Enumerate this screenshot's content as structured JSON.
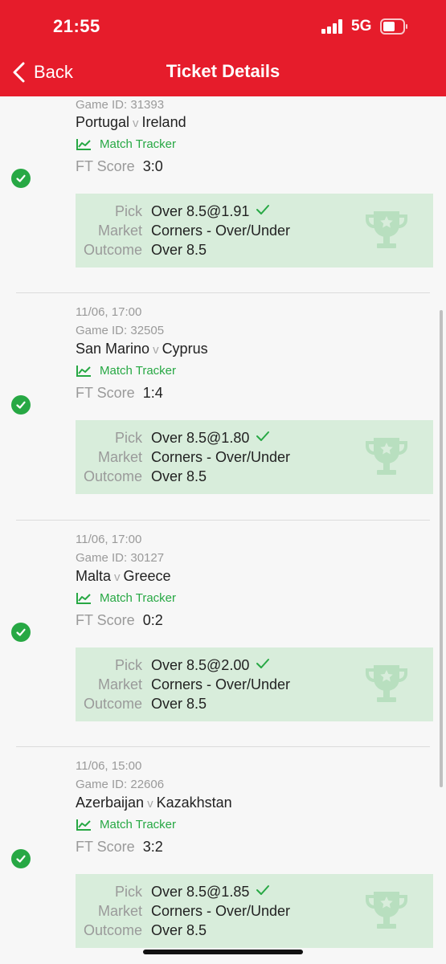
{
  "status_bar": {
    "time": "21:55",
    "network": "5G"
  },
  "nav": {
    "back_label": "Back",
    "title": "Ticket Details"
  },
  "labels": {
    "match_tracker": "Match Tracker",
    "ft_score": "FT Score",
    "pick": "Pick",
    "market": "Market",
    "outcome": "Outcome",
    "vs": "v"
  },
  "matches": [
    {
      "date": "",
      "game_id": "Game ID: 31393",
      "home": "Portugal",
      "away": "Ireland",
      "score": "3:0",
      "pick": "Over 8.5@1.91",
      "market": "Corners - Over/Under",
      "outcome": "Over 8.5"
    },
    {
      "date": "11/06, 17:00",
      "game_id": "Game ID: 32505",
      "home": "San Marino",
      "away": "Cyprus",
      "score": "1:4",
      "pick": "Over 8.5@1.80",
      "market": "Corners - Over/Under",
      "outcome": "Over 8.5"
    },
    {
      "date": "11/06, 17:00",
      "game_id": "Game ID: 30127",
      "home": "Malta",
      "away": "Greece",
      "score": "0:2",
      "pick": "Over 8.5@2.00",
      "market": "Corners - Over/Under",
      "outcome": "Over 8.5"
    },
    {
      "date": "11/06, 15:00",
      "game_id": "Game ID: 22606",
      "home": "Azerbaijan",
      "away": "Kazakhstan",
      "score": "3:2",
      "pick": "Over 8.5@1.85",
      "market": "Corners - Over/Under",
      "outcome": "Over 8.5"
    }
  ]
}
